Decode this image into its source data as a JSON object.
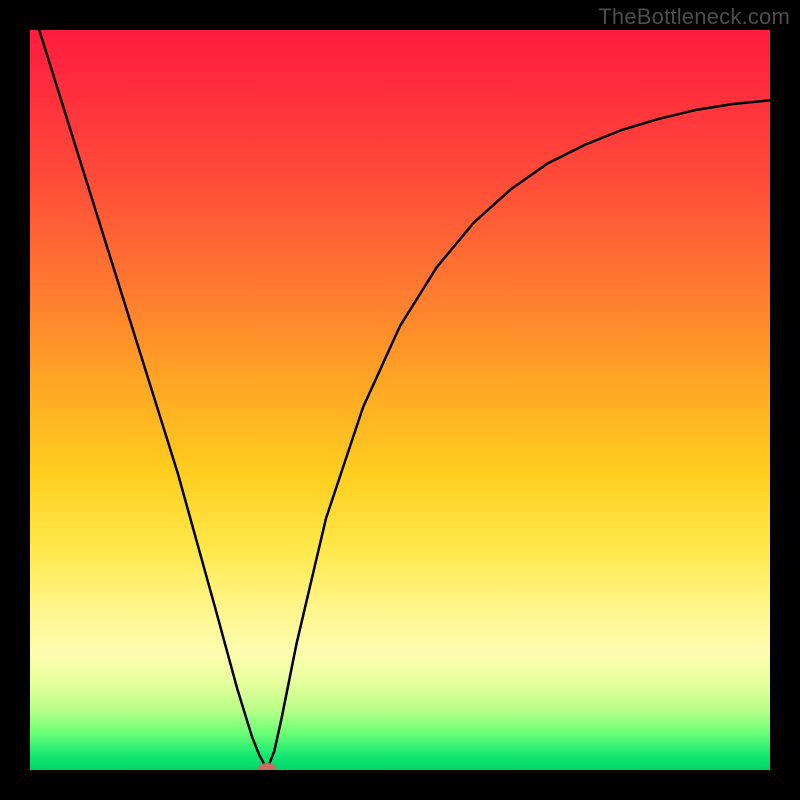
{
  "watermark": "TheBottleneck.com",
  "chart_data": {
    "type": "line",
    "title": "",
    "xlabel": "",
    "ylabel": "",
    "xlim": [
      0,
      1
    ],
    "ylim": [
      0,
      1
    ],
    "grid": false,
    "legend": false,
    "series": [
      {
        "name": "bottleneck-curve",
        "x": [
          0.0,
          0.05,
          0.1,
          0.15,
          0.2,
          0.25,
          0.28,
          0.3,
          0.31,
          0.318,
          0.322,
          0.33,
          0.34,
          0.36,
          0.4,
          0.45,
          0.5,
          0.55,
          0.6,
          0.65,
          0.7,
          0.75,
          0.8,
          0.85,
          0.9,
          0.95,
          1.0
        ],
        "y": [
          1.04,
          0.88,
          0.72,
          0.56,
          0.4,
          0.22,
          0.11,
          0.045,
          0.02,
          0.005,
          0.005,
          0.025,
          0.07,
          0.17,
          0.34,
          0.49,
          0.6,
          0.68,
          0.74,
          0.785,
          0.82,
          0.845,
          0.865,
          0.88,
          0.892,
          0.9,
          0.905
        ]
      }
    ],
    "marker": {
      "x": 0.32,
      "y": 0.002,
      "color": "#cd6b5e"
    },
    "background_gradient": {
      "type": "vertical",
      "stops": [
        {
          "pos": 0.0,
          "color": "#ff1c3f"
        },
        {
          "pos": 0.35,
          "color": "#ff7a30"
        },
        {
          "pos": 0.6,
          "color": "#ffce1f"
        },
        {
          "pos": 0.84,
          "color": "#fdfdb0"
        },
        {
          "pos": 1.0,
          "color": "#00d46a"
        }
      ]
    }
  }
}
